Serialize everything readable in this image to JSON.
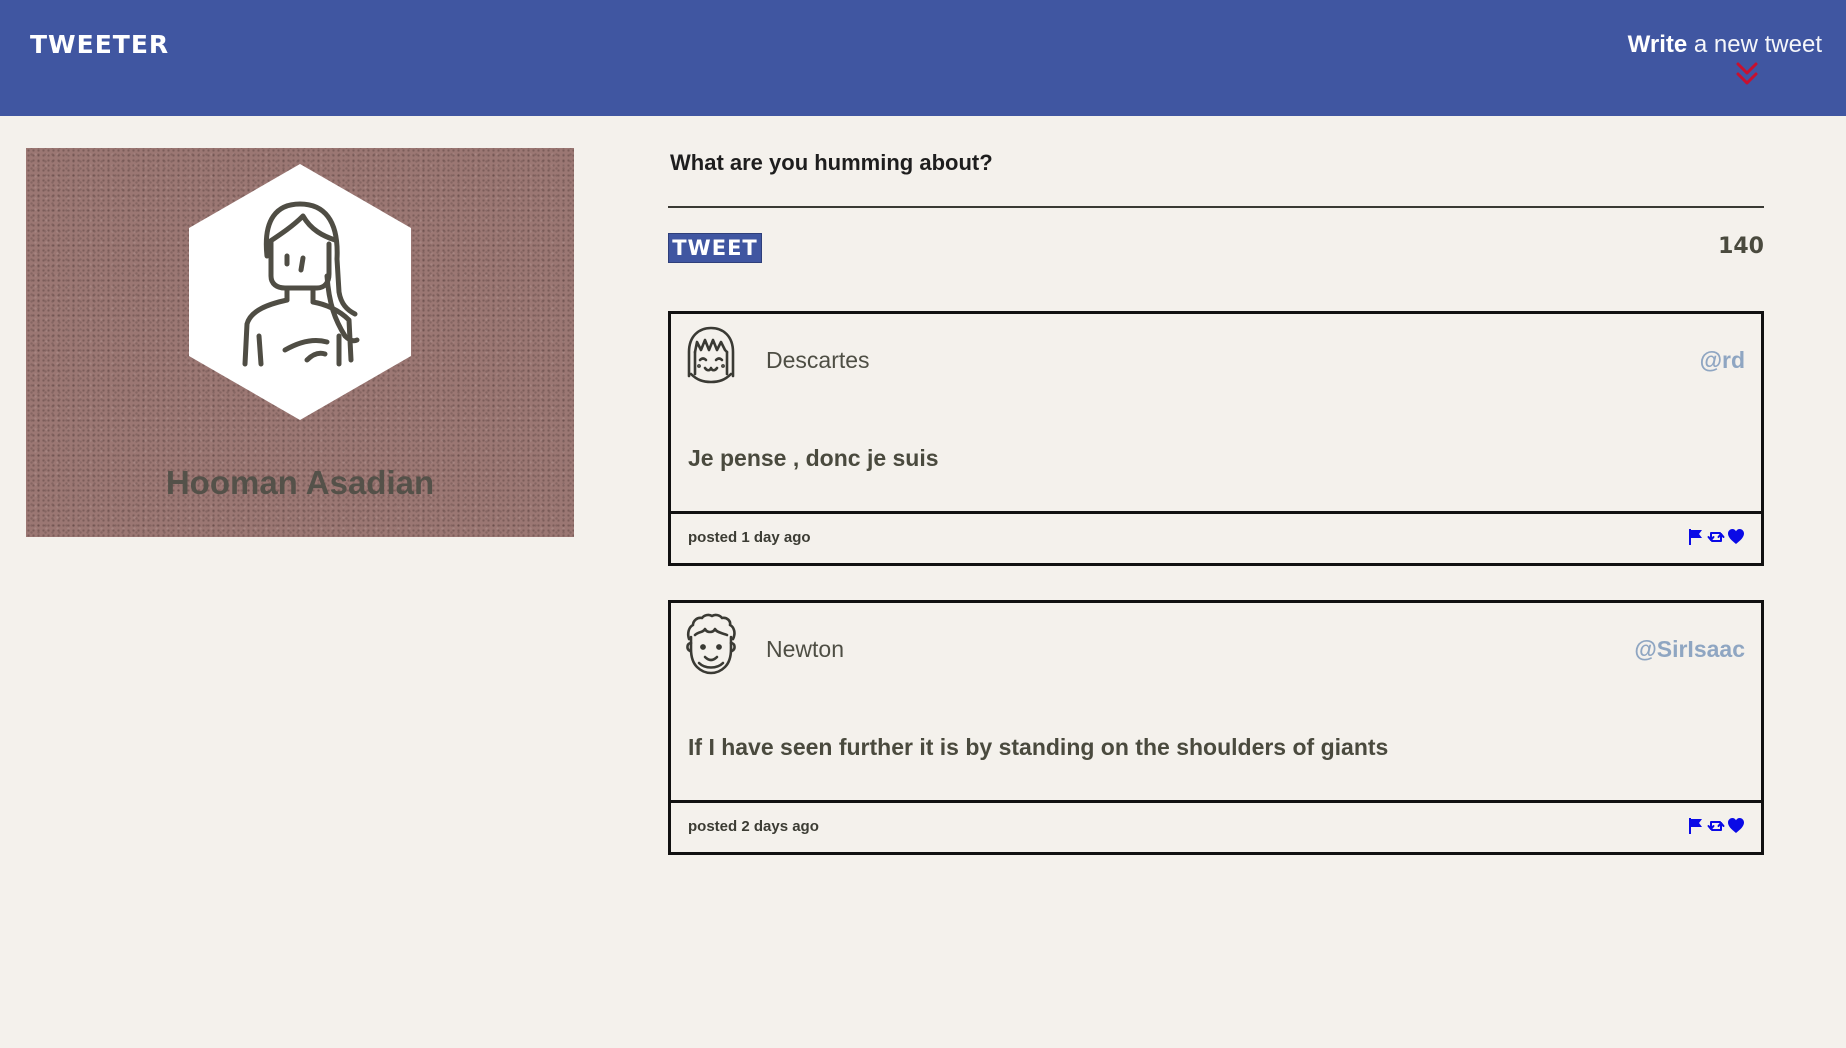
{
  "header": {
    "brand": "TWEETER",
    "compose_strong": "Write",
    "compose_light": " a new tweet",
    "chevron_icon": "double-chevron-down-icon",
    "chevron_color": "#c8102e"
  },
  "profile": {
    "name": "Hooman Asadian",
    "avatar_icon": "woman-avatar-icon"
  },
  "composer": {
    "placeholder": "What are you humming about?",
    "button_label": "TWEET",
    "char_count": "140"
  },
  "tweets": [
    {
      "name": "Descartes",
      "handle": "@rd",
      "text": "Je pense , donc je suis",
      "posted": "posted 1 day ago",
      "avatar_icon": "bob-haircut-face-icon",
      "actions": [
        "flag-icon",
        "retweet-icon",
        "heart-icon"
      ]
    },
    {
      "name": "Newton",
      "handle": "@SirIsaac",
      "text": "If I have seen further it is by standing on the shoulders of giants",
      "posted": "posted 2 days ago",
      "avatar_icon": "curly-hair-face-icon",
      "actions": [
        "flag-icon",
        "retweet-icon",
        "heart-icon"
      ]
    }
  ],
  "colors": {
    "header_bg": "#4056a1",
    "page_bg": "#f4f1ec",
    "profile_bg": "#9b7773",
    "handle": "#8fa6c2",
    "action_icon": "#0a0ae6"
  }
}
